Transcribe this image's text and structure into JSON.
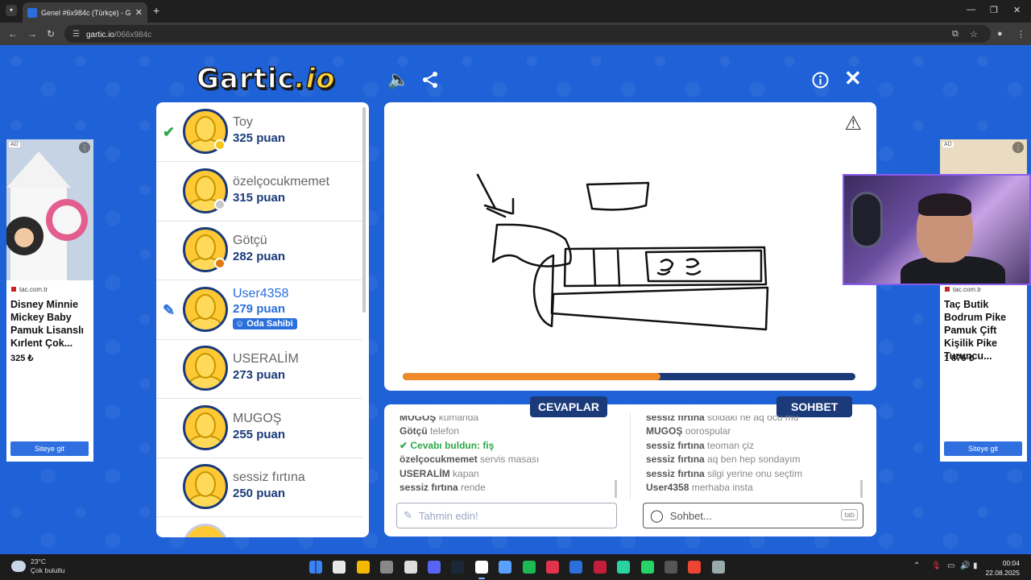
{
  "browser": {
    "tab_title": "Genel #6x984c (Türkçe) - G",
    "url_host": "gartic.io",
    "url_path": "/066x984c"
  },
  "game": {
    "logo": "Gartic",
    "logo_suffix": ".io",
    "players": [
      {
        "name": "Toy",
        "score": "325 puan",
        "status_color": "#f5c518",
        "mark": "check"
      },
      {
        "name": "özelçocukmemet",
        "score": "315 puan",
        "status_color": "#c8c8c8",
        "mark": ""
      },
      {
        "name": "Götçü",
        "score": "282 puan",
        "status_color": "#e07a10",
        "mark": ""
      },
      {
        "name": "User4358",
        "score": "279 puan",
        "status_color": "",
        "mark": "pencil",
        "badge": "Oda Sahibi"
      },
      {
        "name": "USERALİM",
        "score": "273 puan",
        "status_color": "",
        "mark": ""
      },
      {
        "name": "MUGOŞ",
        "score": "255 puan",
        "status_color": "",
        "mark": ""
      },
      {
        "name": "sessiz fırtına",
        "score": "250 puan",
        "status_color": "",
        "mark": ""
      }
    ],
    "timer_progress": 0.57,
    "answers_label": "CEVAPLAR",
    "chat_label": "SOHBET",
    "answers": [
      {
        "user": "MUGOŞ",
        "text": "kumanda"
      },
      {
        "user": "Götçü",
        "text": "telefon"
      },
      {
        "user": "",
        "text": "Cevabı buldun: ",
        "highlight": "fiş"
      },
      {
        "user": "özelçocukmemet",
        "text": "servis masası"
      },
      {
        "user": "USERALİM",
        "text": "kapan"
      },
      {
        "user": "sessiz fırtına",
        "text": "rende"
      }
    ],
    "chat": [
      {
        "user": "sessiz fırtına",
        "text": "soldaki ne aq ocu mu"
      },
      {
        "user": "MUGOŞ",
        "text": "oorospular"
      },
      {
        "user": "sessiz fırtına",
        "text": "teoman çiz"
      },
      {
        "user": "sessiz fırtına",
        "text": "aq ben hep sondayım"
      },
      {
        "user": "sessiz fırtına",
        "text": "silgi yerine onu seçtim"
      },
      {
        "user": "User4358",
        "text": "merhaba insta"
      }
    ],
    "guess_placeholder": "Tahmin edin!",
    "chat_placeholder": "Sohbet...",
    "chat_key_hint": "tab"
  },
  "ads": {
    "left": {
      "tag": "AD",
      "source": "tac.com.tr",
      "title": "Disney Minnie Mickey Baby Pamuk Lisanslı Kırlent Çok...",
      "price": "325 ₺",
      "cta": "Siteye git"
    },
    "right": {
      "tag": "AD",
      "source": "tac.com.tr",
      "title": "Taç Butik Bodrum Pike Pamuk Çift Kişilik Pike Turuncu...",
      "price": "1 875 ₺",
      "cta": "Siteye git"
    }
  },
  "taskbar": {
    "temperature": "23°C",
    "weather": "Çok bulutlu",
    "time": "00:04",
    "date": "22.08.2025"
  }
}
